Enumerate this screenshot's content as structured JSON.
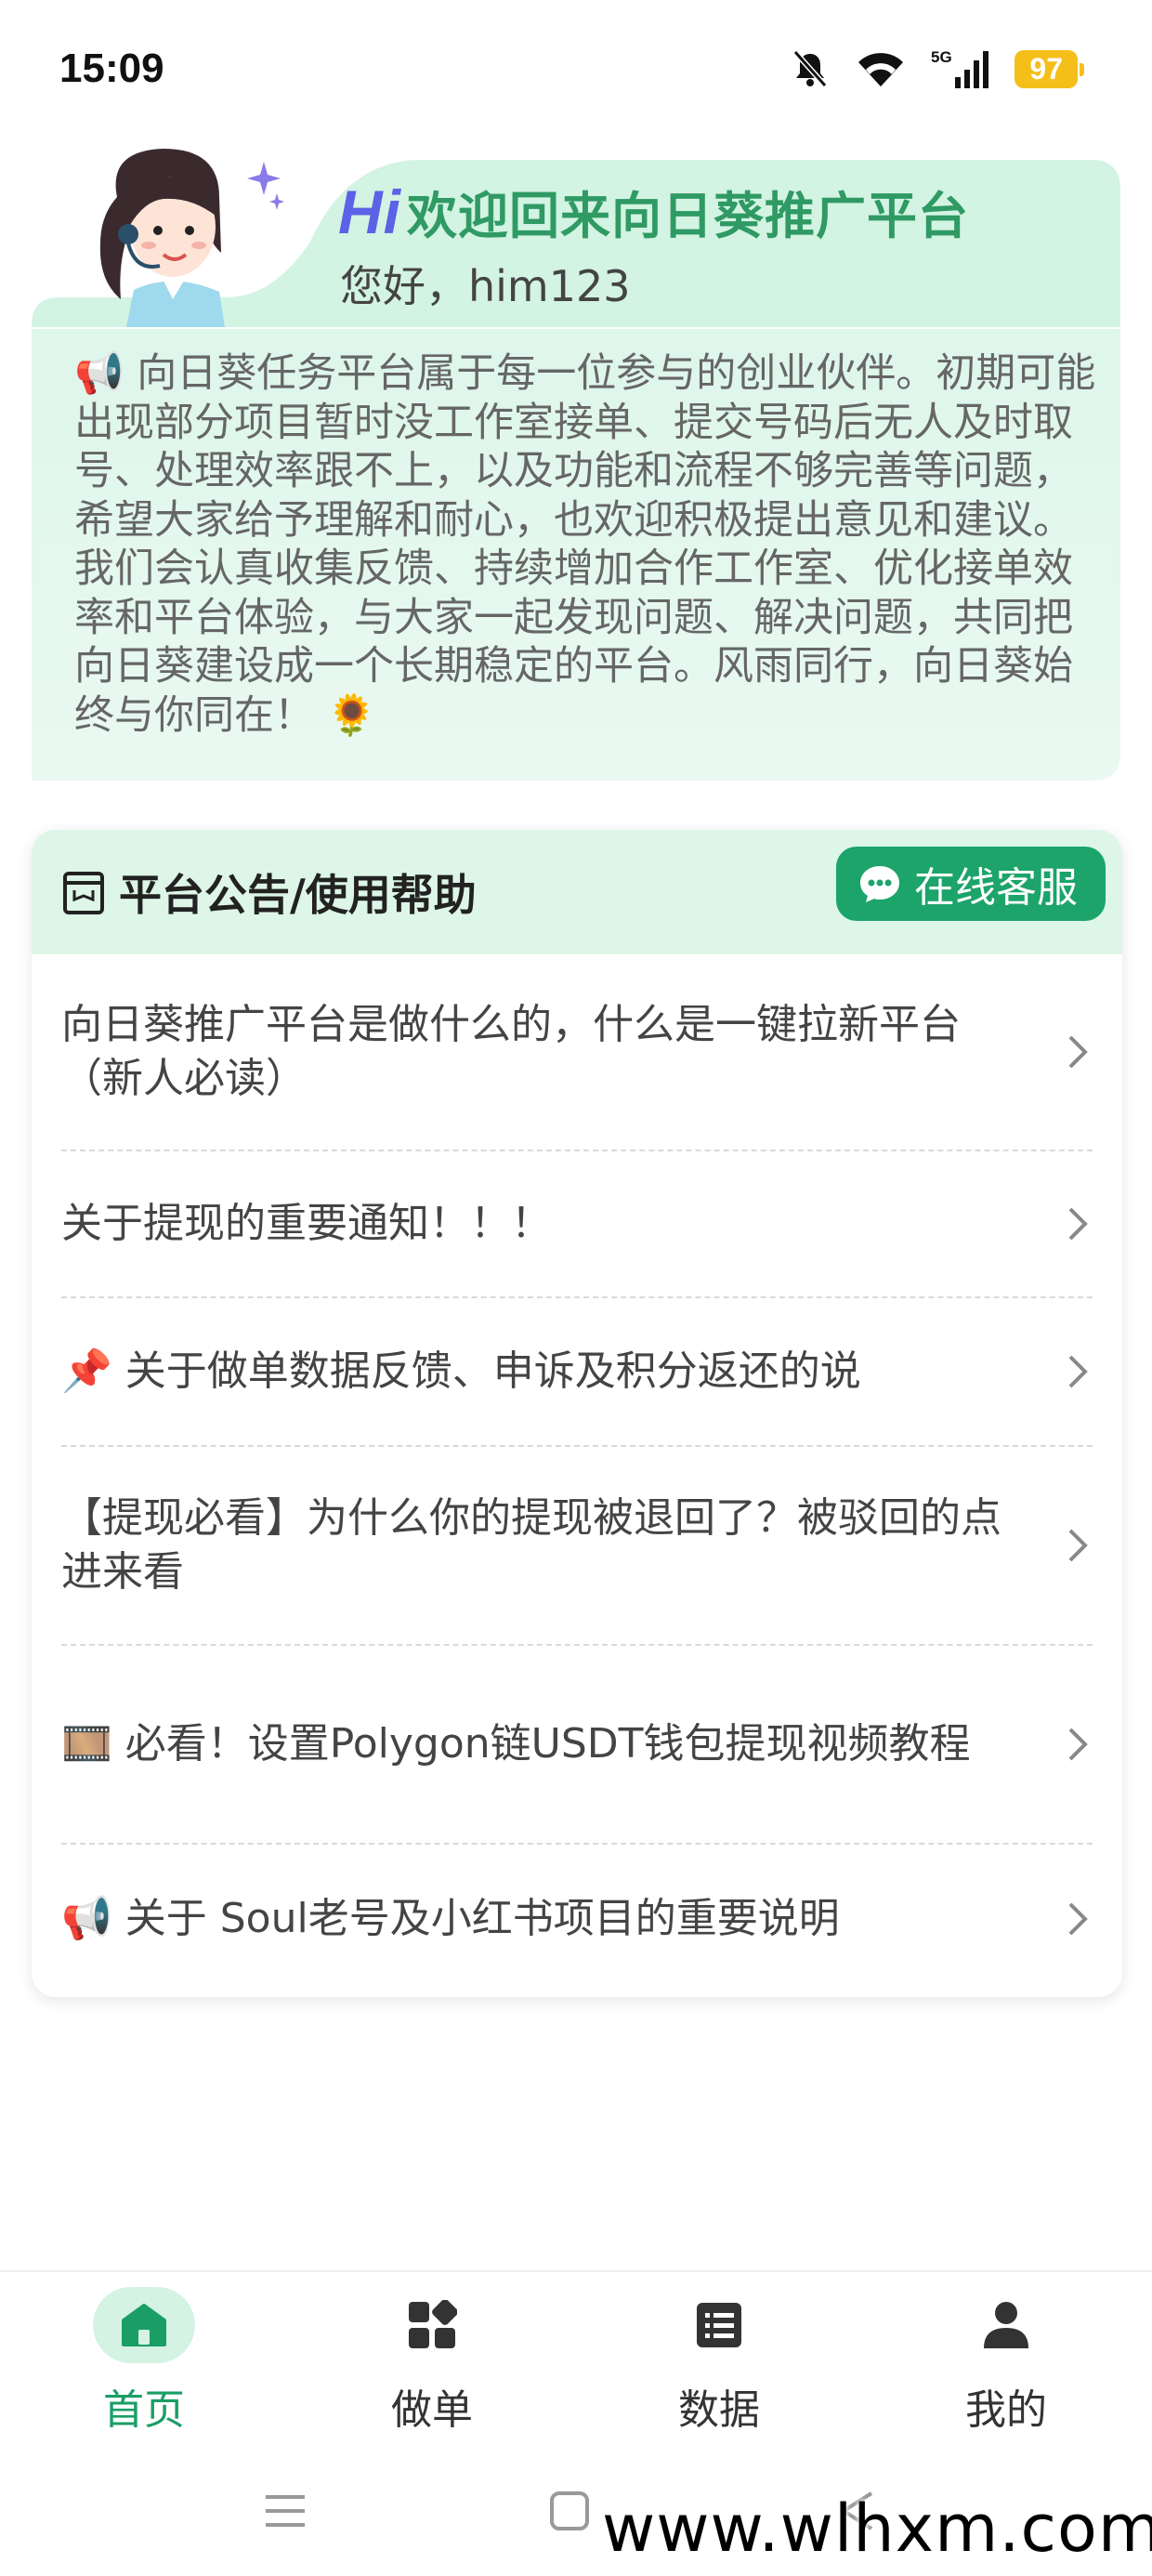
{
  "status_bar": {
    "time": "15:09",
    "network": "5G",
    "battery": "97",
    "icons": [
      "mute-icon",
      "wifi-icon",
      "signal-icon",
      "battery-icon"
    ]
  },
  "welcome": {
    "hi": "Hi",
    "title": "欢迎回来向日葵推广平台",
    "greeting": "您好，him123",
    "notice_emoji": "📢",
    "notice": "向日葵任务平台属于每一位参与的创业伙伴。初期可能出现部分项目暂时没工作室接单、提交号码后无人及时取号、处理效率跟不上，以及功能和流程不够完善等问题，希望大家给予理解和耐心，也欢迎积极提出意见和建议。我们会认真收集反馈、持续增加合作工作室、优化接单效率和平台体验，与大家一起发现问题、解决问题，共同把向日葵建设成一个长期稳定的平台。风雨同行，向日葵始终与你同在！",
    "notice_end_emoji": "🌻"
  },
  "announcements": {
    "title": "平台公告/使用帮助",
    "service_button": "在线客服",
    "items": [
      {
        "label": "向日葵推广平台是做什么的，什么是一键拉新平台（新人必读）"
      },
      {
        "label": "关于提现的重要通知！！！"
      },
      {
        "label": "📌 关于做单数据反馈、申诉及积分返还的说"
      },
      {
        "label": "【提现必看】为什么你的提现被退回了？被驳回的点进来看"
      },
      {
        "label": "🎞️ 必看！设置Polygon链USDT钱包提现视频教程"
      },
      {
        "label": "📢 关于 Soul老号及小红书项目的重要说明"
      }
    ]
  },
  "bottom_nav": {
    "items": [
      {
        "label": "首页",
        "icon": "home-icon",
        "active": true
      },
      {
        "label": "做单",
        "icon": "grid-icon",
        "active": false
      },
      {
        "label": "数据",
        "icon": "list-icon",
        "active": false
      },
      {
        "label": "我的",
        "icon": "user-icon",
        "active": false
      }
    ]
  },
  "watermark": "www.wlhxm.com",
  "colors": {
    "accent": "#1ca46a",
    "header_bg": "#ddf6e8",
    "welcome_bg": "#e3f7ee",
    "hi_color": "#5b62e6",
    "battery": "#f5bf1a"
  }
}
